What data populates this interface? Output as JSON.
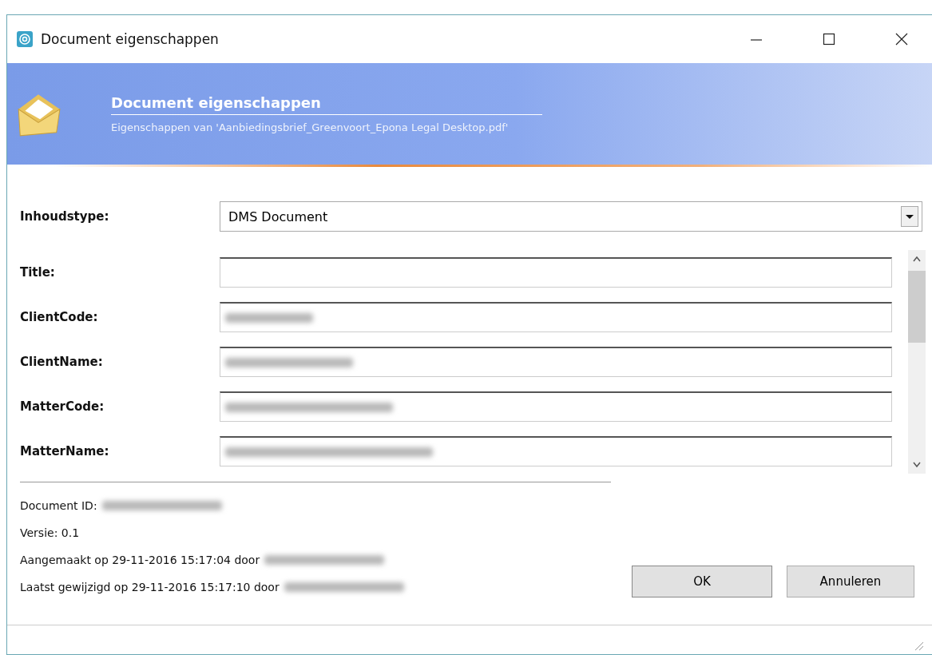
{
  "window": {
    "title": "Document eigenschappen"
  },
  "header": {
    "title": "Document eigenschappen",
    "subtitle": "Eigenschappen van 'Aanbiedingsbrief_Greenvoort_Epona Legal Desktop.pdf'"
  },
  "content_type": {
    "label": "Inhoudstype:",
    "value": "DMS Document"
  },
  "fields": [
    {
      "label": "Title:",
      "redacted": false
    },
    {
      "label": "ClientCode:",
      "redacted": true
    },
    {
      "label": "ClientName:",
      "redacted": true
    },
    {
      "label": "MatterCode:",
      "redacted": true
    },
    {
      "label": "MatterName:",
      "redacted": true
    }
  ],
  "info": [
    {
      "text": "Document ID:",
      "redacted": true
    },
    {
      "text": "Versie: 0.1",
      "redacted": false
    },
    {
      "text": "Aangemaakt op 29-11-2016 15:17:04 door",
      "redacted": true
    },
    {
      "text": "Laatst gewijzigd op 29-11-2016 15:17:10 door",
      "redacted": true
    }
  ],
  "buttons": [
    {
      "label": "OK"
    },
    {
      "label": "Annuleren"
    }
  ]
}
